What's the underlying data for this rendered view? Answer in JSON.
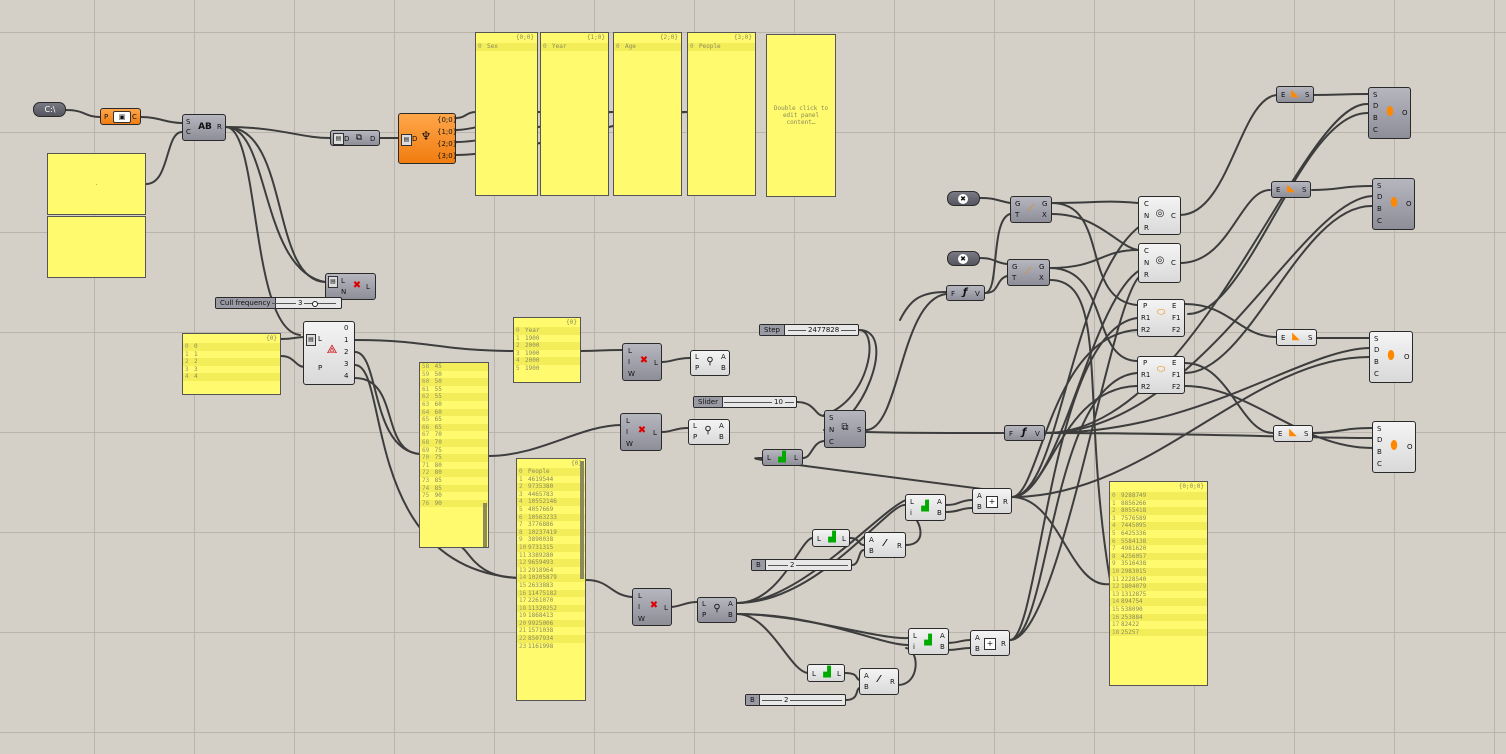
{
  "sliders": {
    "cull_frequency": {
      "label": "Cull frequency",
      "value": "3"
    },
    "step": {
      "label": "Step",
      "value": "2477828"
    },
    "slider": {
      "label": "Slider",
      "value": "10"
    },
    "b1": {
      "label": "B",
      "value": "2"
    },
    "b2": {
      "label": "B",
      "value": "2"
    }
  },
  "panels": {
    "sex": {
      "title": "{0;0}",
      "rows": [
        [
          "0",
          "Sex"
        ]
      ]
    },
    "year": {
      "title": "{1;0}",
      "rows": [
        [
          "0",
          "Year"
        ]
      ]
    },
    "age": {
      "title": "{2;0}",
      "rows": [
        [
          "0",
          "Age"
        ]
      ]
    },
    "people": {
      "title": "{3;0}",
      "rows": [
        [
          "0",
          "People"
        ]
      ]
    },
    "empty_edit": {
      "text": "Double click to edit panel content…"
    },
    "top_left": {
      "text": "."
    },
    "list_5": {
      "title": "{0}",
      "rows": [
        [
          "0",
          "0"
        ],
        [
          "1",
          "1"
        ],
        [
          "2",
          "2"
        ],
        [
          "3",
          "3"
        ],
        [
          "4",
          "4"
        ]
      ]
    },
    "year_list": {
      "title": "{0}",
      "rows": [
        [
          "0",
          "Year"
        ],
        [
          "1",
          "1900"
        ],
        [
          "2",
          "2000"
        ],
        [
          "3",
          "1900"
        ],
        [
          "4",
          "2000"
        ],
        [
          "5",
          "1900"
        ]
      ]
    },
    "age_list": {
      "title": "",
      "rows": [
        [
          "58",
          "45"
        ],
        [
          "59",
          "50"
        ],
        [
          "60",
          "50"
        ],
        [
          "61",
          "55"
        ],
        [
          "62",
          "55"
        ],
        [
          "63",
          "60"
        ],
        [
          "64",
          "60"
        ],
        [
          "65",
          "65"
        ],
        [
          "66",
          "65"
        ],
        [
          "67",
          "70"
        ],
        [
          "68",
          "70"
        ],
        [
          "69",
          "75"
        ],
        [
          "70",
          "75"
        ],
        [
          "71",
          "80"
        ],
        [
          "72",
          "80"
        ],
        [
          "73",
          "85"
        ],
        [
          "74",
          "85"
        ],
        [
          "75",
          "90"
        ],
        [
          "76",
          "90"
        ]
      ]
    },
    "people_list": {
      "title": "{0}",
      "rows": [
        [
          "0",
          "People"
        ],
        [
          "1",
          "4619544"
        ],
        [
          "2",
          "9735380"
        ],
        [
          "3",
          "4465783"
        ],
        [
          "4",
          "10552146"
        ],
        [
          "5",
          "4057669"
        ],
        [
          "6",
          "10563233"
        ],
        [
          "7",
          "3776886"
        ],
        [
          "8",
          "10237419"
        ],
        [
          "9",
          "3890038"
        ],
        [
          "10",
          "9731315"
        ],
        [
          "11",
          "3389280"
        ],
        [
          "12",
          "9659493"
        ],
        [
          "13",
          "2918964"
        ],
        [
          "14",
          "10205879"
        ],
        [
          "15",
          "2633883"
        ],
        [
          "16",
          "11475182"
        ],
        [
          "17",
          "2261070"
        ],
        [
          "18",
          "11320252"
        ],
        [
          "19",
          "1868413"
        ],
        [
          "20",
          "9925006"
        ],
        [
          "21",
          "1571038"
        ],
        [
          "22",
          "8507934"
        ],
        [
          "23",
          "1161998"
        ]
      ]
    },
    "result_list": {
      "title": "{0;0;0}",
      "rows": [
        [
          "0",
          "9288749"
        ],
        [
          "1",
          "8856266"
        ],
        [
          "2",
          "8055418"
        ],
        [
          "3",
          "7576589"
        ],
        [
          "4",
          "7445095"
        ],
        [
          "5",
          "6425336"
        ],
        [
          "6",
          "5584138"
        ],
        [
          "7",
          "4981620"
        ],
        [
          "8",
          "4256057"
        ],
        [
          "9",
          "3516438"
        ],
        [
          "10",
          "2983015"
        ],
        [
          "11",
          "2228540"
        ],
        [
          "12",
          "1804079"
        ],
        [
          "13",
          "1312875"
        ],
        [
          "14",
          "894754"
        ],
        [
          "15",
          "538090"
        ],
        [
          "16",
          "253884"
        ],
        [
          "17",
          "82422"
        ],
        [
          "18",
          "25257"
        ]
      ]
    }
  },
  "components": {
    "file_path": {
      "icon": "C:\\"
    },
    "read_file": {
      "in": "P",
      "out": "C"
    },
    "split_text": {
      "ins": [
        "S",
        "C"
      ],
      "out": "R"
    },
    "list_to_tree": {
      "in": "D",
      "out": "D"
    },
    "explode_tree": {
      "in": "D",
      "outs": [
        "{0;0}",
        "{1;0}",
        "{2;0}",
        "{3;0}"
      ]
    },
    "cull_index": {
      "ins": [
        "L",
        "N"
      ],
      "out": "L"
    },
    "partition": {
      "ins": [
        "L",
        "P"
      ],
      "outs": [
        "0",
        "1",
        "2",
        "3",
        "4"
      ]
    },
    "cull_pattern_1": {
      "ins": [
        "L",
        "I",
        "W"
      ],
      "out": "L"
    },
    "cull_pattern_2": {
      "ins": [
        "L",
        "I",
        "W"
      ],
      "out": "L"
    },
    "cull_pattern_3": {
      "ins": [
        "L",
        "I",
        "W"
      ],
      "out": "L"
    },
    "weave_1": {
      "ins": [
        "L",
        "P"
      ],
      "outs": [
        "A",
        "B"
      ]
    },
    "weave_2": {
      "ins": [
        "L",
        "P"
      ],
      "outs": [
        "A",
        "B"
      ]
    },
    "weave_3": {
      "ins": [
        "L",
        "P"
      ],
      "outs": [
        "A",
        "B"
      ]
    },
    "series": {
      "ins": [
        "S",
        "N",
        "C"
      ],
      "out": "S"
    },
    "bounds": {
      "in": "L",
      "out": "L"
    },
    "list_len_1": {
      "in": "L",
      "out": "L"
    },
    "list_len_2": {
      "in": "L",
      "out": "L"
    },
    "divide_1": {
      "ins": [
        "A",
        "B"
      ],
      "out": "R"
    },
    "divide_2": {
      "ins": [
        "A",
        "B"
      ],
      "out": "R"
    },
    "list_item_1": {
      "ins": [
        "L",
        "i"
      ],
      "outs": [
        "A",
        "B"
      ]
    },
    "list_item_2": {
      "ins": [
        "L",
        "i"
      ],
      "outs": [
        "A",
        "B"
      ]
    },
    "addition_1": {
      "ins": [
        "A",
        "B"
      ],
      "out": "R"
    },
    "addition_2": {
      "ins": [
        "A",
        "B"
      ],
      "out": "R"
    },
    "circle_1": {
      "ins": [
        "C",
        "N",
        "R"
      ],
      "out": "C"
    },
    "circle_2": {
      "ins": [
        "C",
        "N",
        "R"
      ],
      "out": "C"
    },
    "ellipse_1": {
      "ins": [
        "P",
        "R1",
        "R2"
      ],
      "outs": [
        "E",
        "F1",
        "F2"
      ]
    },
    "ellipse_2": {
      "ins": [
        "P",
        "R1",
        "R2"
      ],
      "outs": [
        "E",
        "F1",
        "F2"
      ]
    },
    "gradient_1": {
      "ins": [
        "G",
        "T"
      ],
      "outs": [
        "G",
        "X"
      ]
    },
    "gradient_2": {
      "ins": [
        "G",
        "T"
      ],
      "outs": [
        "G",
        "X"
      ]
    },
    "func_1": {
      "in": "F",
      "out": "V"
    },
    "func_2": {
      "in": "F",
      "out": "V"
    },
    "surface_1": {
      "in": "E",
      "out": "S"
    },
    "surface_2": {
      "in": "E",
      "out": "S"
    },
    "surface_3": {
      "in": "E",
      "out": "S"
    },
    "surface_4": {
      "in": "E",
      "out": "S"
    },
    "preview_1": {
      "ins": [
        "S",
        "D",
        "B",
        "C"
      ],
      "out": "O"
    },
    "preview_2": {
      "ins": [
        "S",
        "D",
        "B",
        "C"
      ],
      "out": "O"
    },
    "preview_3": {
      "ins": [
        "S",
        "D",
        "B",
        "C"
      ],
      "out": "O"
    },
    "preview_4": {
      "ins": [
        "S",
        "D",
        "B",
        "C"
      ],
      "out": "O"
    }
  },
  "colors": {
    "panel": "#fffa6e",
    "component": "#9a9aa5",
    "orange": "#f5841e",
    "wire": "#3a3a3a",
    "canvas": "#d4d0c8"
  }
}
